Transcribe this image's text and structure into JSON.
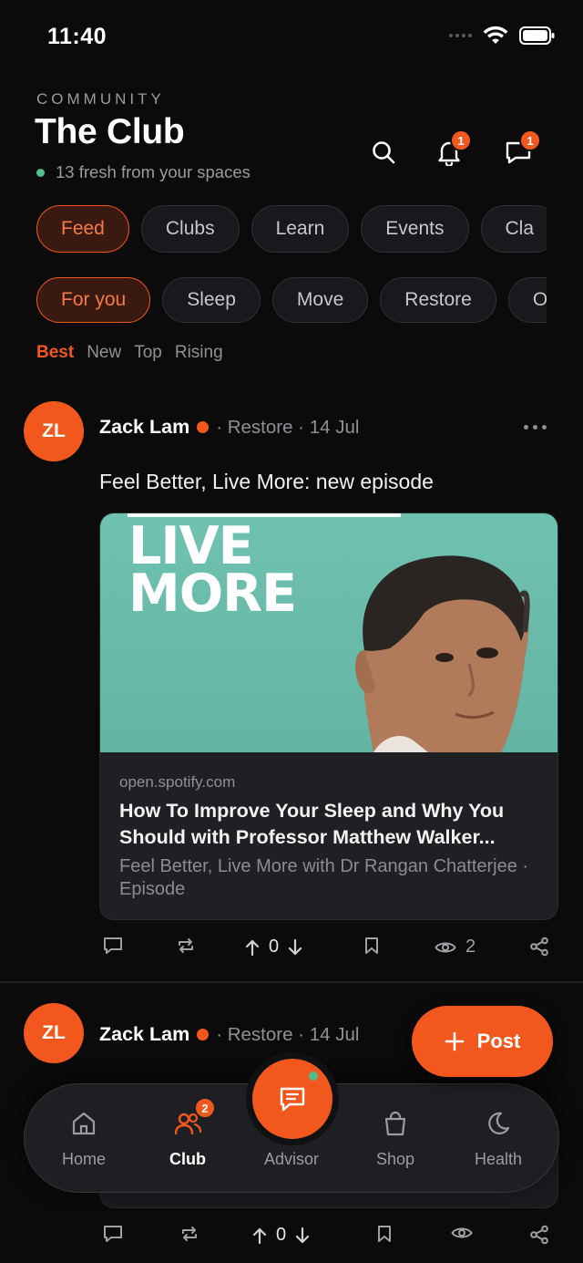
{
  "status_bar": {
    "time": "11:40"
  },
  "header": {
    "overline": "COMMUNITY",
    "title": "The Club",
    "subtitle": "13 fresh from your spaces",
    "notifications_badge": "1",
    "messages_badge": "1"
  },
  "tabs": [
    "Feed",
    "Clubs",
    "Learn",
    "Events",
    "Cla"
  ],
  "filters": [
    "For you",
    "Sleep",
    "Move",
    "Restore",
    "Ol"
  ],
  "sort": [
    "Best",
    "New",
    "Top",
    "Rising"
  ],
  "posts": [
    {
      "avatar_initials": "ZL",
      "author": "Zack Lam",
      "meta": "· Restore · 14 Jul",
      "text": "Feel Better, Live More: new episode",
      "card": {
        "image_words": [
          "LIVE",
          "MORE"
        ],
        "domain": "open.spotify.com",
        "title": "How To Improve Your Sleep and Why You Should with Professor Matthew Walker...",
        "subtitle": "Feel Better, Live More with Dr Rangan Chatterjee · Episode"
      },
      "votes": "0",
      "views": "2"
    },
    {
      "avatar_initials": "ZL",
      "author": "Zack Lam",
      "meta": "· Restore · 14 Jul",
      "votes": "0"
    }
  ],
  "fab": {
    "label": "Post"
  },
  "bottom_nav": {
    "items": [
      "Home",
      "Club",
      "Advisor",
      "Shop",
      "Health"
    ],
    "club_badge": "2"
  },
  "colors": {
    "accent": "#f2581e",
    "online": "#4fc08d",
    "background": "#0b0b0c"
  }
}
